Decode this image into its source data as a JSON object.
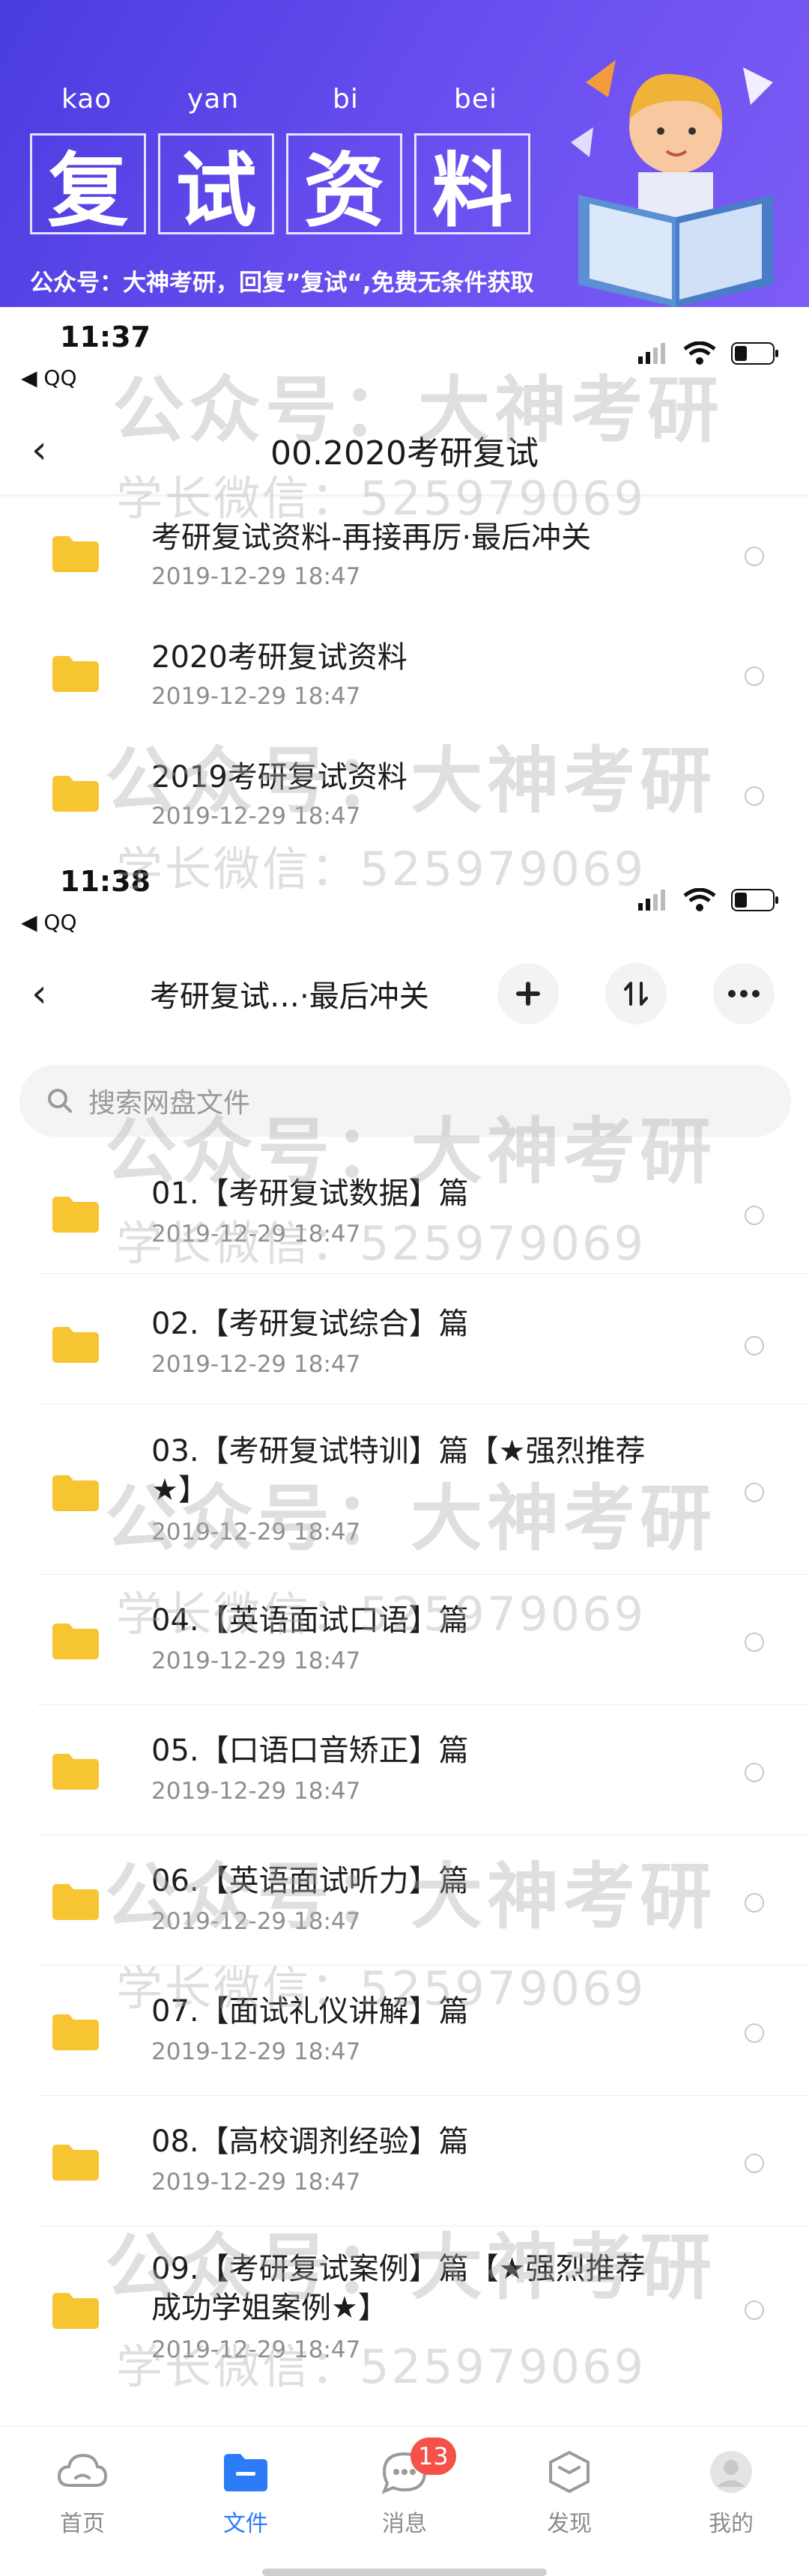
{
  "banner": {
    "pinyin": [
      "kao",
      "yan",
      "bi",
      "bei"
    ],
    "chars": [
      "复",
      "试",
      "资",
      "料"
    ],
    "subtitle": "公众号：大神考研，回复”复试“,免费无条件获取"
  },
  "screen1": {
    "time": "11:37",
    "back_app": "◀ QQ",
    "title": "00.2020考研复试",
    "files": [
      {
        "name": "考研复试资料-再接再厉·最后冲关",
        "date": "2019-12-29 18:47"
      },
      {
        "name": "2020考研复试资料",
        "date": "2019-12-29 18:47"
      },
      {
        "name": "2019考研复试资料",
        "date": "2019-12-29 18:47"
      }
    ]
  },
  "screen2": {
    "time": "11:38",
    "back_app": "◀ QQ",
    "title": "考研复试…·最后冲关",
    "search_placeholder": "搜索网盘文件",
    "files": [
      {
        "name": "01.【考研复试数据】篇",
        "date": "2019-12-29 18:47"
      },
      {
        "name": "02.【考研复试综合】篇",
        "date": "2019-12-29 18:47"
      },
      {
        "name": "03.【考研复试特训】篇【★强烈推荐★】",
        "date": "2019-12-29 18:47"
      },
      {
        "name": "04.【英语面试口语】篇",
        "date": "2019-12-29 18:47"
      },
      {
        "name": "05.【口语口音矫正】篇",
        "date": "2019-12-29 18:47"
      },
      {
        "name": "06.【英语面试听力】篇",
        "date": "2019-12-29 18:47"
      },
      {
        "name": "07.【面试礼仪讲解】篇",
        "date": "2019-12-29 18:47"
      },
      {
        "name": "08.【高校调剂经验】篇",
        "date": "2019-12-29 18:47"
      },
      {
        "name": "09.【考研复试案例】篇【★强烈推荐 成功学姐案例★】",
        "date": "2019-12-29 18:47"
      }
    ]
  },
  "tabbar": {
    "tabs": [
      {
        "label": "首页",
        "icon": "cloud-icon"
      },
      {
        "label": "文件",
        "icon": "folder-icon"
      },
      {
        "label": "消息",
        "icon": "chat-icon",
        "badge": "13"
      },
      {
        "label": "发现",
        "icon": "cube-icon"
      },
      {
        "label": "我的",
        "icon": "avatar-icon"
      }
    ],
    "active_color": "#2b7cf6"
  },
  "watermarks": {
    "wechat_account": "公众号：大神考研",
    "senior_wechat": "学长微信：525979069"
  },
  "colors": {
    "folder": "#f7c531",
    "banner": "#5a46ea",
    "badge": "#f4514b"
  }
}
